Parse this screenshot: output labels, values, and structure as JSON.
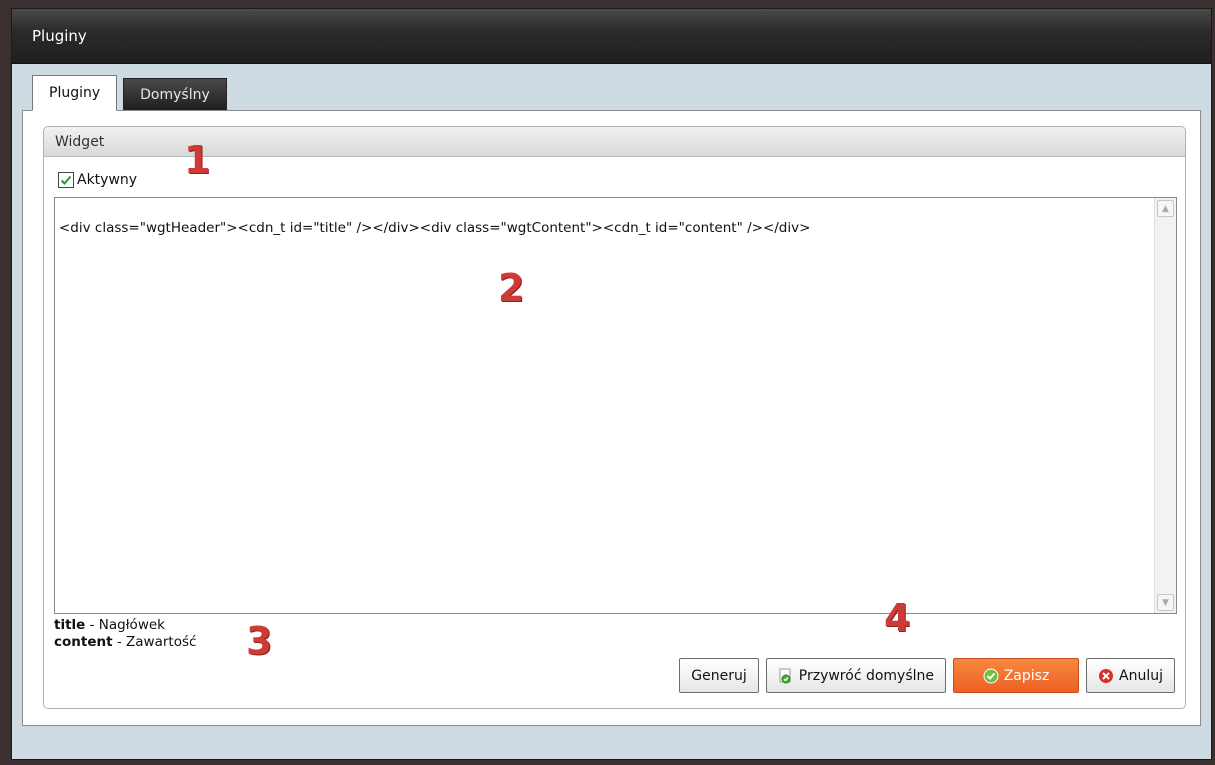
{
  "window": {
    "title": "Pluginy"
  },
  "tabs": [
    {
      "label": "Pluginy",
      "active": true
    },
    {
      "label": "Domyślny",
      "active": false
    }
  ],
  "section": {
    "title": "Widget"
  },
  "active_checkbox": {
    "label": "Aktywny",
    "checked": true
  },
  "editor": {
    "content": "<div class=\"wgtHeader\"><cdn_t id=\"title\" /></div><div class=\"wgtContent\"><cdn_t id=\"content\" /></div>"
  },
  "legend": [
    {
      "key": "title",
      "desc": " - Nagłówek"
    },
    {
      "key": "content",
      "desc": " - Zawartość"
    }
  ],
  "buttons": {
    "generate": "Generuj",
    "restore": "Przywróć domyślne",
    "save": "Zapisz",
    "cancel": "Anuluj"
  },
  "markers": [
    "1",
    "2",
    "3",
    "4"
  ],
  "colors": {
    "titlebar": "#2b2b2b",
    "background": "#cfdbe3",
    "primary_button": "#ee5f24",
    "marker": "#cc3b36"
  }
}
